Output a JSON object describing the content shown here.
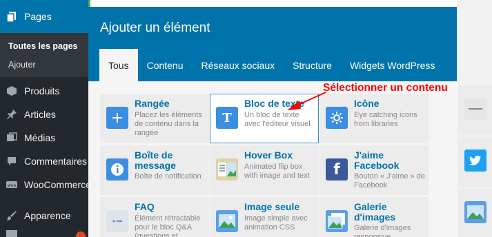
{
  "sidebar": {
    "active": {
      "label": "Pages",
      "icon": "pages-icon"
    },
    "submenu": [
      {
        "label": "Toutes les pages",
        "current": true
      },
      {
        "label": "Ajouter",
        "current": false
      }
    ],
    "items": [
      {
        "label": "Produits",
        "icon": "products-icon"
      },
      {
        "label": "Articles",
        "icon": "pin-icon"
      },
      {
        "label": "Médias",
        "icon": "media-icon"
      },
      {
        "label": "Commentaires",
        "icon": "comment-icon"
      },
      {
        "label": "WooCommerce",
        "icon": "woo-icon"
      },
      {
        "label": "Apparence",
        "icon": "brush-icon"
      }
    ]
  },
  "modal": {
    "title": "Ajouter un élément",
    "tabs": [
      {
        "label": "Tous",
        "active": true
      },
      {
        "label": "Contenu",
        "active": false
      },
      {
        "label": "Réseaux sociaux",
        "active": false
      },
      {
        "label": "Structure",
        "active": false
      },
      {
        "label": "Widgets WordPress",
        "active": false
      }
    ],
    "elements": [
      {
        "title": "Rangée",
        "desc": "Placez les éléments de contenu dans la rangée",
        "icon": "plus-icon",
        "color": "#3b8ee0"
      },
      {
        "title": "Bloc de texte",
        "desc": "Un bloc de texte avec l'éditeur visuel",
        "icon": "text-block-icon",
        "color": "#3b8ee0",
        "selected": true
      },
      {
        "title": "Icône",
        "desc": "Eye catching icons from libraries",
        "icon": "sun-icon",
        "color": "#3b8ee0"
      },
      {
        "title": "Boîte de message",
        "desc": "Boîte de notification",
        "icon": "info-icon",
        "color": "#3b8ee0"
      },
      {
        "title": "Hover Box",
        "desc": "Animated flip box with image and text",
        "icon": "hover-box-icon",
        "color": "#dcd3a8"
      },
      {
        "title": "J'aime Facebook",
        "desc": "Bouton « J'aime » de Facebook",
        "icon": "facebook-icon",
        "color": "#3b5998"
      },
      {
        "title": "FAQ",
        "desc": "Élément rétractable pour le bloc Q&A (questions et",
        "icon": "faq-icon",
        "color": "#dde3ea"
      },
      {
        "title": "Image seule",
        "desc": "Image simple avec animation CSS",
        "icon": "image-icon",
        "color": "#5aa0e6"
      },
      {
        "title": "Galerie d'images",
        "desc": "Galerie d'images responsive",
        "icon": "gallery-icon",
        "color": "#5aa0e6"
      }
    ]
  },
  "annotation": {
    "text": "Sélectionner  un contenu"
  },
  "colors": {
    "wp_blue": "#0073aa",
    "sidebar_dark": "#23282d",
    "annotation_red": "#ff0000"
  }
}
